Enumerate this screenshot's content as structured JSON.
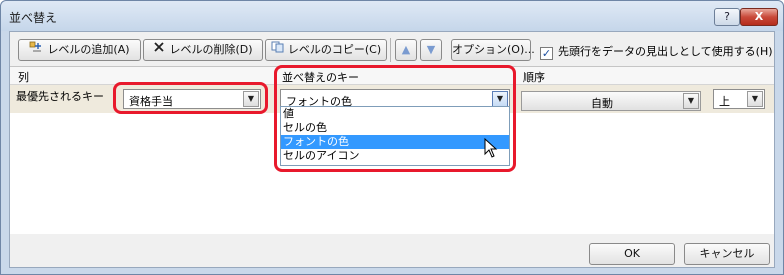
{
  "window": {
    "title": "並べ替え",
    "help_label": "?",
    "close_label": "X"
  },
  "toolbar": {
    "add_label": "レベルの追加(A)",
    "delete_label": "レベルの削除(D)",
    "copy_label": "レベルのコピー(C)",
    "options_label": "オプション(O)...",
    "header_checkbox_label": "先頭行をデータの見出しとして使用する(H)",
    "header_checkbox_checked": true
  },
  "columns": {
    "col": "列",
    "sortkey": "並べ替えのキー",
    "order": "順序"
  },
  "row": {
    "label": "最優先されるキー",
    "column_value": "資格手当",
    "sortkey_value": "フォントの色",
    "order_value": "自動",
    "order_direction": "上"
  },
  "dropdown": {
    "options": [
      "値",
      "セルの色",
      "フォントの色",
      "セルのアイコン"
    ],
    "highlighted": "フォントの色"
  },
  "footer": {
    "ok_label": "OK",
    "cancel_label": "キャンセル"
  },
  "colors": {
    "highlight": "#3399ff",
    "annotation_red": "#e8192c"
  }
}
